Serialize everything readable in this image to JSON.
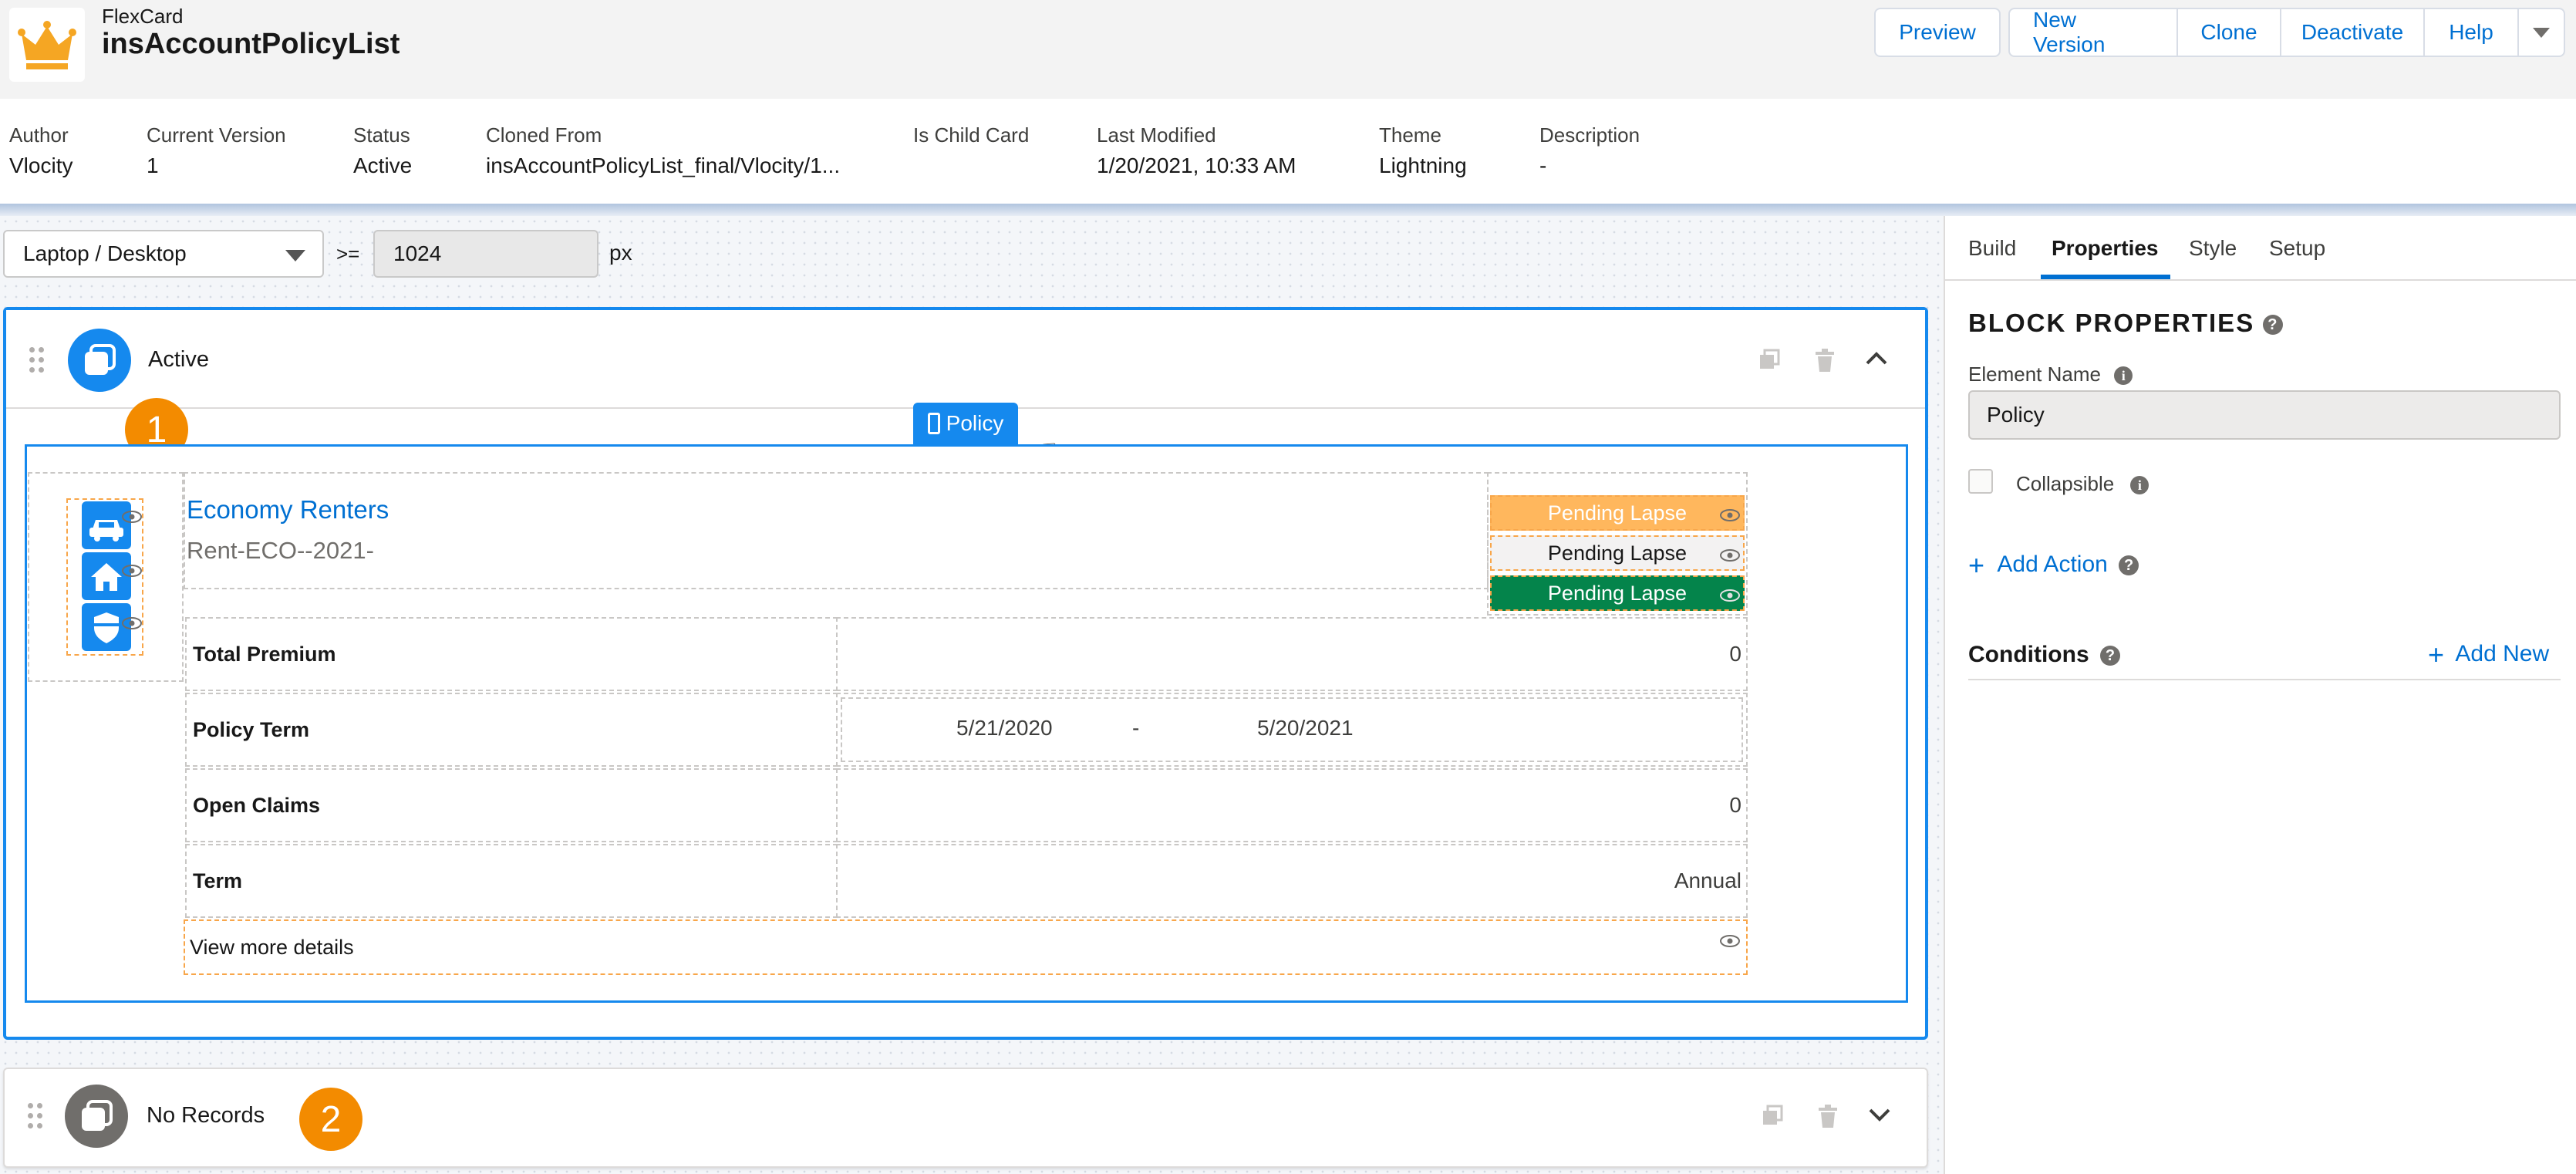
{
  "header": {
    "type_label": "FlexCard",
    "card_name": "insAccountPolicyList",
    "buttons": {
      "preview": "Preview",
      "new_version": "New Version",
      "clone": "Clone",
      "deactivate": "Deactivate",
      "help": "Help"
    }
  },
  "meta": [
    {
      "label": "Author",
      "value": "Vlocity"
    },
    {
      "label": "Current Version",
      "value": "1"
    },
    {
      "label": "Status",
      "value": "Active"
    },
    {
      "label": "Cloned From",
      "value": "insAccountPolicyList_final/Vlocity/1..."
    },
    {
      "label": "Is Child Card",
      "value": ""
    },
    {
      "label": "Last Modified",
      "value": "1/20/2021, 10:33 AM"
    },
    {
      "label": "Theme",
      "value": "Lightning"
    },
    {
      "label": "Description",
      "value": "-"
    }
  ],
  "toolbar": {
    "device": "Laptop / Desktop",
    "operator": ">=",
    "breakpoint": "1024",
    "unit": "px"
  },
  "states": {
    "active": {
      "label": "Active",
      "badge": "1"
    },
    "no_records": {
      "label": "No Records",
      "badge": "2"
    }
  },
  "card": {
    "block_tab": "Policy",
    "title": "Economy Renters",
    "subtitle": "Rent-ECO--2021-",
    "status_labels": [
      "Pending Lapse",
      "Pending Lapse",
      "Pending Lapse"
    ],
    "rows": [
      {
        "label": "Total Premium",
        "value": "0"
      },
      {
        "label": "Policy Term",
        "start": "5/21/2020",
        "sep": "-",
        "end": "5/20/2021"
      },
      {
        "label": "Open Claims",
        "value": "0"
      },
      {
        "label": "Term",
        "value": "Annual"
      }
    ],
    "view_more": "View more details"
  },
  "panel": {
    "tabs": [
      "Build",
      "Properties",
      "Style",
      "Setup"
    ],
    "active_tab": "Properties",
    "section_title": "BLOCK PROPERTIES",
    "element_name_label": "Element Name",
    "element_name_value": "Policy",
    "collapsible_label": "Collapsible",
    "add_action": "Add Action",
    "conditions_label": "Conditions",
    "add_new": "Add New"
  },
  "colors": {
    "brand": "#0070d2",
    "selection": "#1589ee",
    "badge": "#f38b00",
    "pending_orange": "#ffb75d",
    "pending_green": "#04844b"
  }
}
